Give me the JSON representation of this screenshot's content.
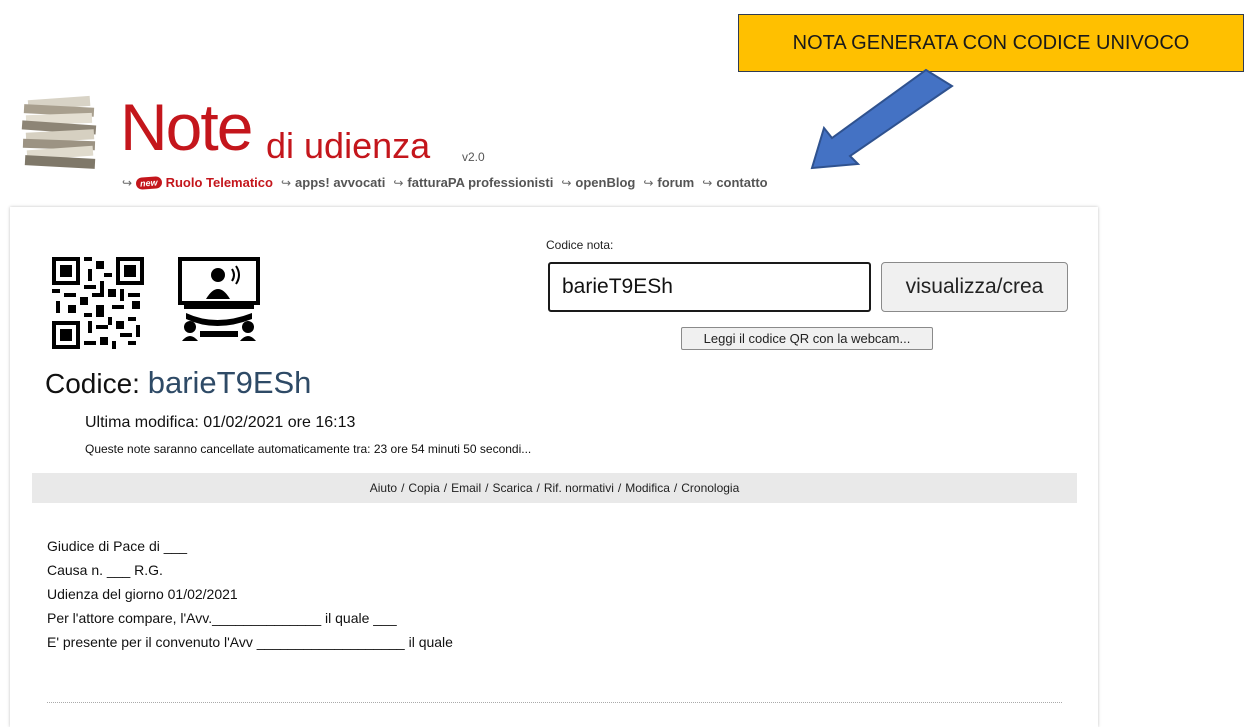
{
  "annotation": {
    "callout_text": "NOTA GENERATA CON CODICE UNIVOCO",
    "callout_color": "#ffc000",
    "arrow_color": "#4472c4"
  },
  "logo": {
    "word_note": "Note",
    "word_udienza": "di udienza",
    "version": "v2.0",
    "brand_color": "#c4161c"
  },
  "nav": {
    "new_badge": "new",
    "items": [
      "Ruolo Telematico",
      "apps! avvocati",
      "fatturaPA professionisti",
      "openBlog",
      "forum",
      "contatto"
    ]
  },
  "form": {
    "code_label": "Codice nota:",
    "code_value": "barieT9ESh",
    "submit_label": "visualizza/crea",
    "webcam_label": "Leggi il codice QR con la webcam..."
  },
  "note": {
    "title_prefix": "Codice:",
    "code": "barieT9ESh",
    "last_modified": "Ultima modifica: 01/02/2021 ore 16:13",
    "expiry": "Queste note saranno cancellate automaticamente tra: 23 ore 54 minuti 50 secondi..."
  },
  "toolbar": {
    "items": [
      "Aiuto",
      "Copia",
      "Email",
      "Scarica",
      "Rif. normativi",
      "Modifica",
      "Cronologia"
    ],
    "separator": "/"
  },
  "content": {
    "lines": [
      "Giudice di Pace di ___",
      "Causa n. ___ R.G.",
      "Udienza del giorno 01/02/2021",
      "Per l'attore compare, l'Avv.______________ il quale ___",
      "E' presente per il convenuto l'Avv ___________________ il quale"
    ]
  },
  "icons": [
    "papers-stack-icon",
    "qr-code-icon",
    "meeting-room-icon",
    "arrow-annotation-icon"
  ]
}
